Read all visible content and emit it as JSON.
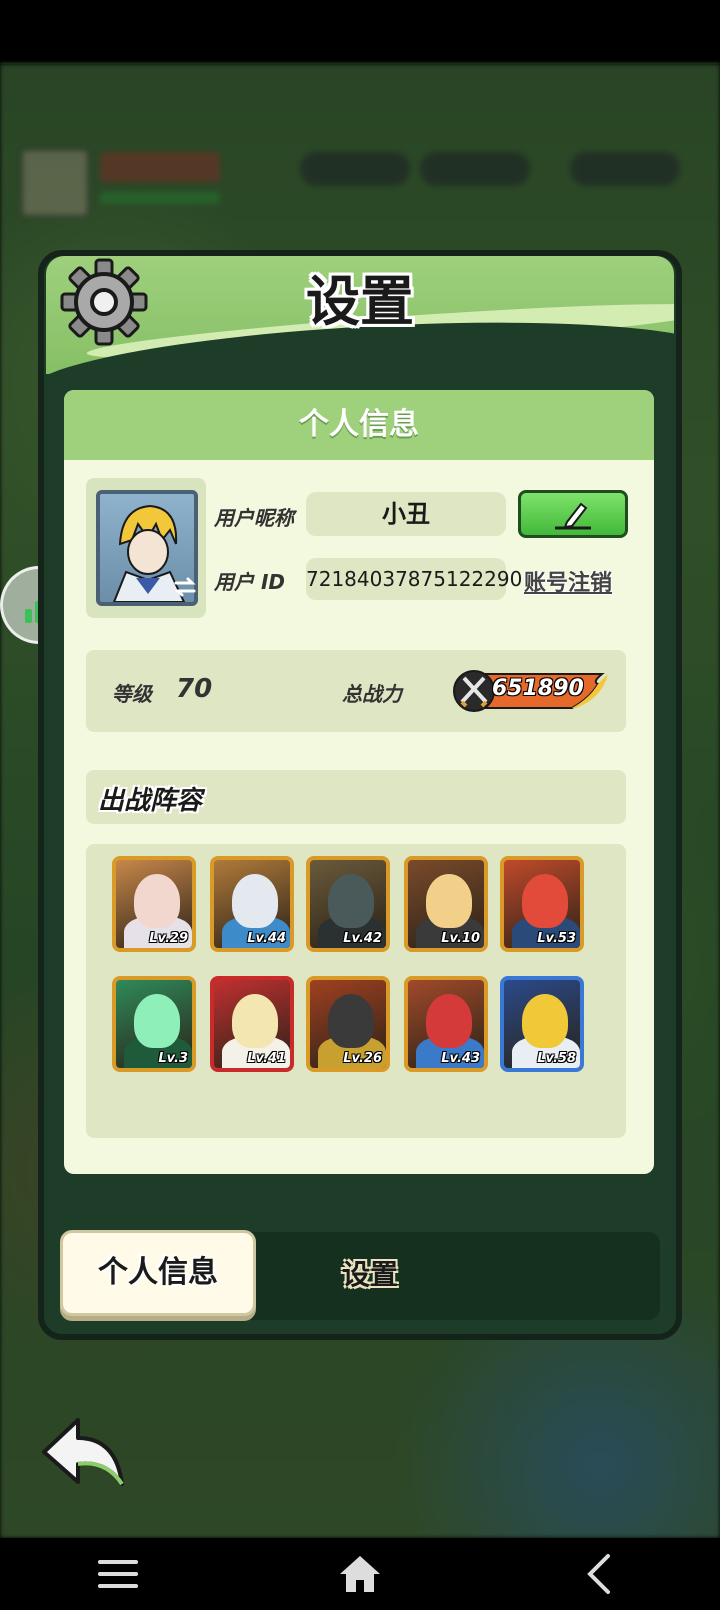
{
  "dialog": {
    "title": "设置",
    "section_header": "个人信息"
  },
  "profile": {
    "nickname_label": "用户昵称",
    "nickname": "小丑",
    "id_label": "用户 ID",
    "id_value": "72184037875122290",
    "cancel_account_label": "账号注销",
    "level_label": "等级",
    "level_value": "70",
    "power_label": "总战力",
    "power_value": "651890"
  },
  "lineup": {
    "title": "出战阵容",
    "heroes": [
      {
        "lv": "Lv.29",
        "frame": "#d99a28",
        "bg": "#c8874a",
        "face": "#f2d7cf",
        "body": "#e6e0e8"
      },
      {
        "lv": "Lv.44",
        "frame": "#d99a28",
        "bg": "#b07a3a",
        "face": "#e4e9f0",
        "body": "#3d8cc9"
      },
      {
        "lv": "Lv.42",
        "frame": "#d99a28",
        "bg": "#6a5a3a",
        "face": "#4a5a5a",
        "body": "#2b3030"
      },
      {
        "lv": "Lv.10",
        "frame": "#d99a28",
        "bg": "#7a4a2a",
        "face": "#f2d08a",
        "body": "#3a3a3a"
      },
      {
        "lv": "Lv.53",
        "frame": "#d99a28",
        "bg": "#c04a2a",
        "face": "#e24a3a",
        "body": "#2a4a7a"
      },
      {
        "lv": "Lv.3",
        "frame": "#d99a28",
        "bg": "#2f8a5a",
        "face": "#8ef0b8",
        "body": "#1f5a3a"
      },
      {
        "lv": "Lv.41",
        "frame": "#c92a2a",
        "bg": "#c03030",
        "face": "#f3e6b0",
        "body": "#f4f1e8"
      },
      {
        "lv": "Lv.26",
        "frame": "#d99a28",
        "bg": "#a04020",
        "face": "#3a3a3a",
        "body": "#c7a030"
      },
      {
        "lv": "Lv.43",
        "frame": "#d99a28",
        "bg": "#a04a2a",
        "face": "#d43a3a",
        "body": "#3a7ac9"
      },
      {
        "lv": "Lv.58",
        "frame": "#3a78d6",
        "bg": "#2a4a8a",
        "face": "#f0c838",
        "body": "#e8eef4"
      }
    ]
  },
  "tabs": {
    "active": "个人信息",
    "inactive": "设置"
  },
  "colors": {
    "panel_green": "#9fd07c",
    "panel_dark": "#1d3d28",
    "content_bg": "#f3f9de",
    "edit_green": "#42b83a",
    "power_orange": "#e25a2a"
  }
}
